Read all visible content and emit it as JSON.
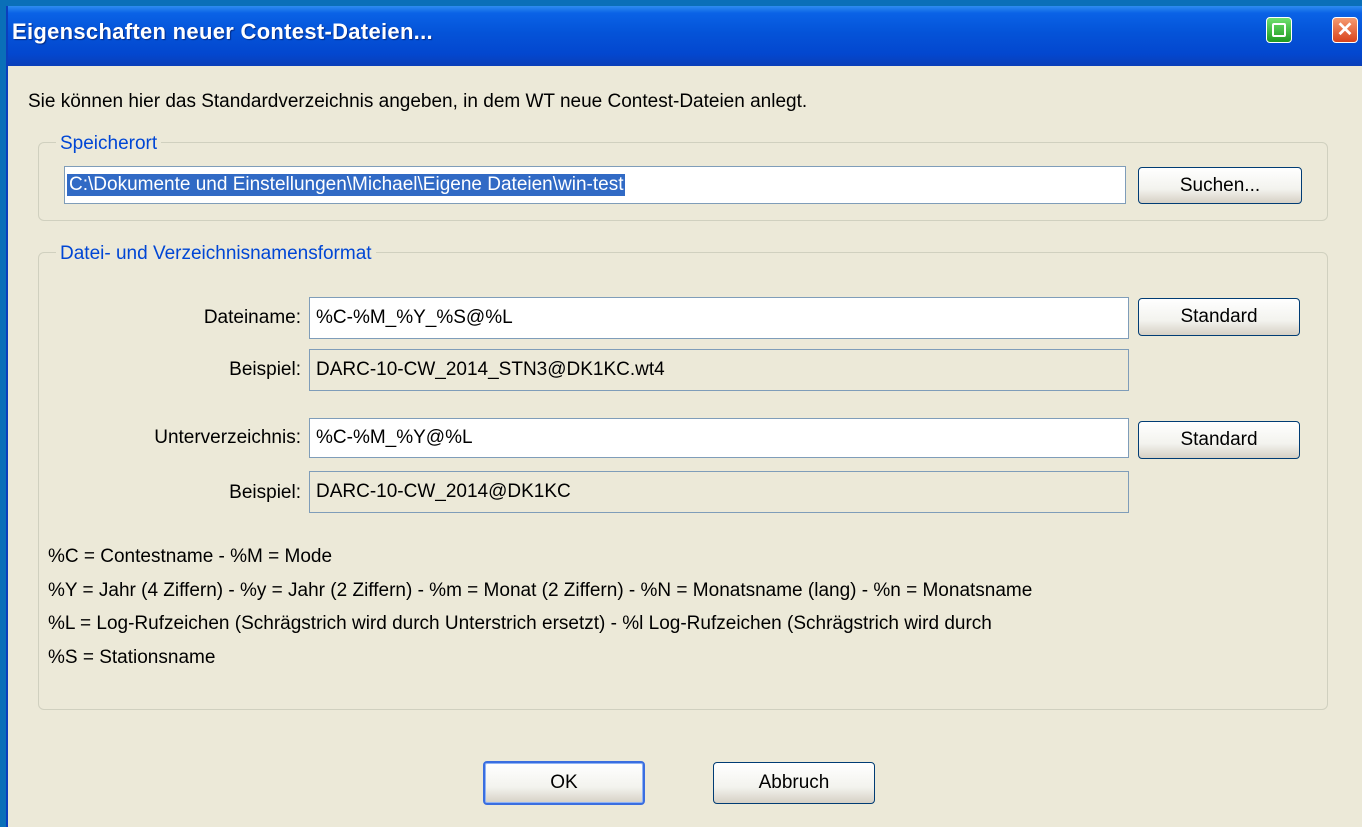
{
  "window": {
    "title": "Eigenschaften neuer Contest-Dateien...",
    "close_glyph": "✕"
  },
  "intro": "Sie können hier das Standardverzeichnis angeben, in dem WT neue Contest-Dateien anlegt.",
  "location_group": {
    "legend": "Speicherort",
    "path_value": "C:\\Dokumente und Einstellungen\\Michael\\Eigene Dateien\\win-test",
    "search_button": "Suchen..."
  },
  "format_group": {
    "legend": "Datei- und Verzeichnisnamensformat",
    "filename_label": "Dateiname:",
    "filename_value": "%C-%M_%Y_%S@%L",
    "filename_std_button": "Standard",
    "example1_label": "Beispiel:",
    "example1_value": "DARC-10-CW_2014_STN3@DK1KC.wt4",
    "subdir_label": "Unterverzeichnis:",
    "subdir_value": "%C-%M_%Y@%L",
    "subdir_std_button": "Standard",
    "example2_label": "Beispiel:",
    "example2_value": "DARC-10-CW_2014@DK1KC",
    "notes": [
      "%C = Contestname - %M = Mode",
      "%Y = Jahr (4 Ziffern) - %y = Jahr (2 Ziffern) - %m = Monat (2 Ziffern) - %N = Monatsname (lang) - %n = Monatsname",
      "%L = Log-Rufzeichen (Schrägstrich wird durch Unterstrich ersetzt) - %l Log-Rufzeichen (Schrägstrich wird durch",
      "%S = Stationsname"
    ]
  },
  "buttons": {
    "ok": "OK",
    "cancel": "Abbruch"
  },
  "colors": {
    "titlebar": "#0453d8",
    "dialog_bg": "#ece9d8",
    "legend_text": "#0046d5",
    "selection": "#316ac5"
  },
  "icons": {
    "titlebar_left": "green-window-icon",
    "titlebar_right": "close-icon"
  }
}
